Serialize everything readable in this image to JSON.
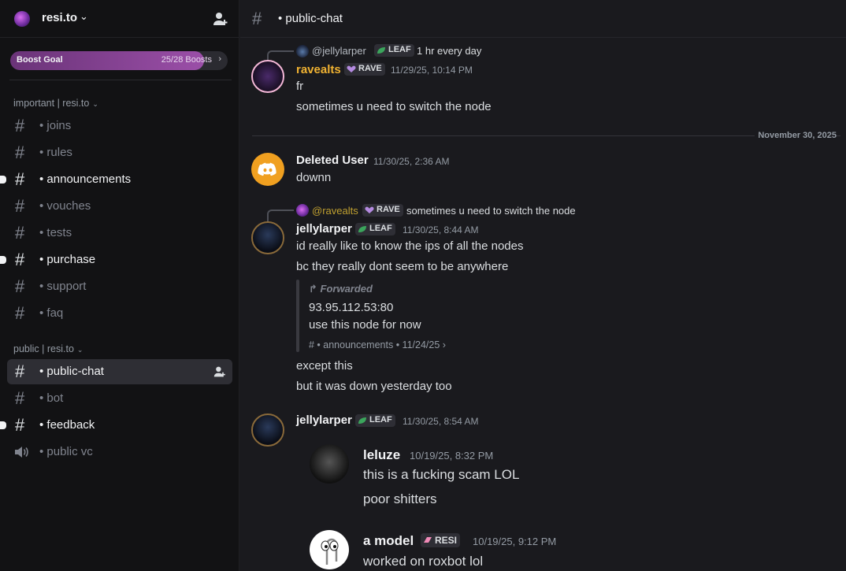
{
  "server": {
    "name": "resi.to"
  },
  "boost": {
    "label": "Boost Goal",
    "count": "25/28 Boosts",
    "progress": 0.893
  },
  "categories": [
    {
      "label": "important | resi.to"
    },
    {
      "label": "public | resi.to"
    }
  ],
  "channels": [
    {
      "label": "• joins",
      "state": "muted"
    },
    {
      "label": "• rules",
      "state": "muted"
    },
    {
      "label": "• announcements",
      "state": "unread"
    },
    {
      "label": "• vouches",
      "state": "muted"
    },
    {
      "label": "• tests",
      "state": "muted"
    },
    {
      "label": "• purchase",
      "state": "unread"
    },
    {
      "label": "• support",
      "state": "muted"
    },
    {
      "label": "• faq",
      "state": "muted"
    },
    {
      "label": "• public-chat",
      "state": "active"
    },
    {
      "label": "• bot",
      "state": "muted"
    },
    {
      "label": "• feedback",
      "state": "unread"
    },
    {
      "label": "• public vc",
      "state": "voice"
    }
  ],
  "header": {
    "channel": "• public-chat"
  },
  "messages": {
    "m1": {
      "reply_name": "@jellylarper",
      "reply_tag": "LEAF",
      "reply_text": "1 hr every day",
      "author": "ravealts",
      "author_color": "#f0b232",
      "tag": "RAVE",
      "time": "11/29/25, 10:14 PM",
      "lines": [
        "fr",
        "sometimes u need to switch the node"
      ]
    },
    "date_separator": "November 30, 2025",
    "m2": {
      "author": "Deleted User",
      "time": "11/30/25, 2:36 AM",
      "lines": [
        "downn"
      ]
    },
    "m3": {
      "reply_name": "@ravealts",
      "reply_tag": "RAVE",
      "reply_text": "sometimes u need to switch the node",
      "author": "jellylarper",
      "tag": "LEAF",
      "time": "11/30/25, 8:44 AM",
      "lines": [
        "id really like to know the ips of all the nodes",
        "bc they really dont seem to be anywhere"
      ],
      "forward": {
        "label": "Forwarded",
        "lines": [
          "93.95.112.53:80",
          "use this node for now"
        ],
        "source": "# • announcements • 11/24/25 ›"
      },
      "after": [
        "except this",
        "but it was down yesterday too"
      ]
    },
    "m4": {
      "author": "jellylarper",
      "tag": "LEAF",
      "time": "11/30/25, 8:54 AM",
      "embedded": [
        {
          "author": "leluze",
          "time": "10/19/25, 8:32 PM",
          "lines": [
            "this is a fucking scam LOL",
            "poor shitters"
          ]
        },
        {
          "author": "a model",
          "tag": "RESI",
          "time": "10/19/25, 9:12 PM",
          "lines": [
            "worked on roxbot lol"
          ]
        }
      ]
    }
  },
  "colors": {
    "leaf": "#3ba55c",
    "rave": "#b48ae0",
    "resi": "#f08ab8",
    "discord_orange": "#f0a020"
  }
}
